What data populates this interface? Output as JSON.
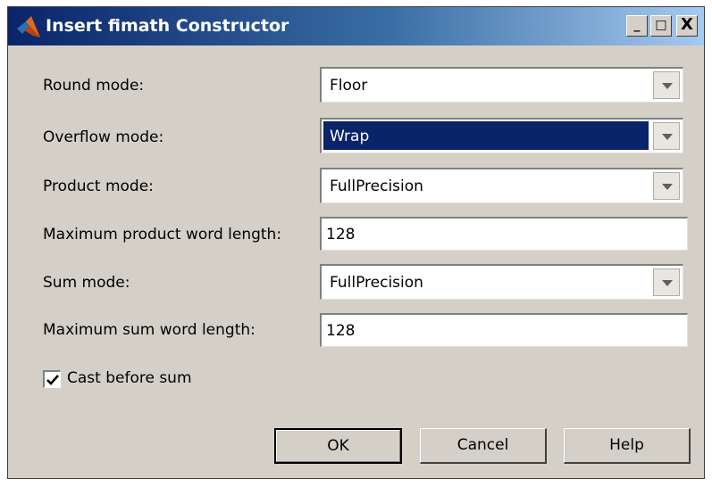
{
  "window": {
    "title": "Insert fimath Constructor",
    "minimize_glyph": "_",
    "maximize_glyph": "□",
    "close_glyph": "X"
  },
  "fields": {
    "round_mode": {
      "label": "Round mode:",
      "value": "Floor"
    },
    "overflow_mode": {
      "label": "Overflow mode:",
      "value": "Wrap"
    },
    "product_mode": {
      "label": "Product mode:",
      "value": "FullPrecision"
    },
    "max_product_word_length": {
      "label": "Maximum product word length:",
      "value": "128"
    },
    "sum_mode": {
      "label": "Sum mode:",
      "value": "FullPrecision"
    },
    "max_sum_word_length": {
      "label": "Maximum sum word length:",
      "value": "128"
    }
  },
  "cast_before_sum": {
    "label": "Cast before sum",
    "checked": true
  },
  "buttons": {
    "ok": "OK",
    "cancel": "Cancel",
    "help": "Help"
  },
  "colors": {
    "titlebar_start": "#0a246a",
    "titlebar_end": "#a6caf0",
    "dialog_bg": "#d4d0c8",
    "selection": "#0a246a"
  },
  "icons": {
    "title": "matlab-logo-icon",
    "combo_arrow": "chevron-down-icon",
    "checkbox": "checkmark-icon"
  }
}
